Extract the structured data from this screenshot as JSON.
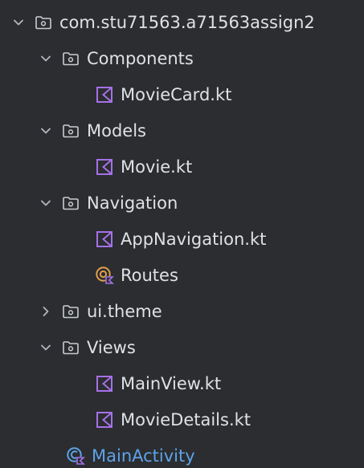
{
  "tree": {
    "root": {
      "label": "com.stu71563.a71563assign2",
      "expanded": true,
      "icon": "package-folder-icon"
    },
    "components": {
      "label": "Components",
      "expanded": true,
      "icon": "package-folder-icon",
      "children": [
        {
          "label": "MovieCard.kt",
          "icon": "kotlin-file-icon"
        }
      ]
    },
    "models": {
      "label": "Models",
      "expanded": true,
      "icon": "package-folder-icon",
      "children": [
        {
          "label": "Movie.kt",
          "icon": "kotlin-file-icon"
        }
      ]
    },
    "navigation": {
      "label": "Navigation",
      "expanded": true,
      "icon": "package-folder-icon",
      "children": [
        {
          "label": "AppNavigation.kt",
          "icon": "kotlin-file-icon"
        },
        {
          "label": "Routes",
          "icon": "kotlin-object-icon"
        }
      ]
    },
    "ui_theme": {
      "label": "ui.theme",
      "expanded": false,
      "icon": "package-folder-icon"
    },
    "views": {
      "label": "Views",
      "expanded": true,
      "icon": "package-folder-icon",
      "children": [
        {
          "label": "MainView.kt",
          "icon": "kotlin-file-icon"
        },
        {
          "label": "MovieDetails.kt",
          "icon": "kotlin-file-icon"
        }
      ]
    },
    "main_activity": {
      "label": "MainActivity",
      "icon": "kotlin-class-icon"
    }
  },
  "colors": {
    "background": "#2b2d30",
    "text": "#dfe1e5",
    "chevron": "#b4b8bf",
    "folder": "#c9ccd1",
    "kotlin_purple": "#a571e6",
    "object_orange": "#e39f4b",
    "class_blue": "#5ea3e8"
  }
}
